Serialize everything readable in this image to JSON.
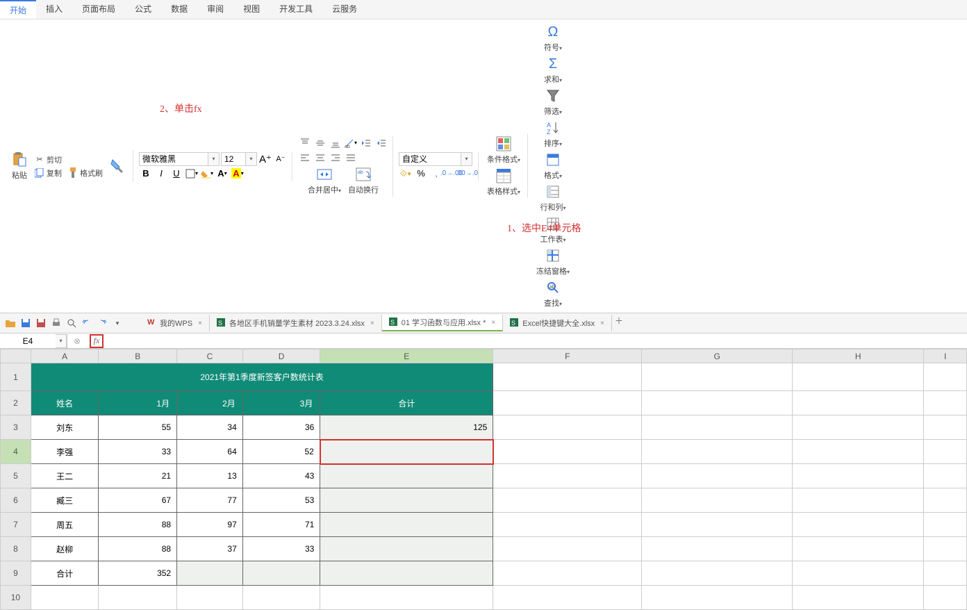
{
  "menu": {
    "tabs": [
      "开始",
      "插入",
      "页面布局",
      "公式",
      "数据",
      "审阅",
      "视图",
      "开发工具",
      "云服务"
    ],
    "active": 0
  },
  "ribbon": {
    "paste": "粘贴",
    "cut": "剪切",
    "copy": "复制",
    "format_painter": "格式刷",
    "font_name": "微软雅黑",
    "font_size": "12",
    "merge": "合并居中",
    "wrap": "自动换行",
    "num_format": "自定义",
    "cond_fmt": "条件格式",
    "table_style": "表格样式",
    "symbols": "符号",
    "sum": "求和",
    "filter": "筛选",
    "sort": "排序",
    "format": "格式",
    "rowcol": "行和列",
    "sheet": "工作表",
    "freeze": "冻结窗格",
    "find": "查找"
  },
  "doc_tabs": {
    "items": [
      {
        "label": "我的WPS",
        "icon": "wps"
      },
      {
        "label": "各地区手机销量学生素材 2023.3.24.xlsx",
        "icon": "excel"
      },
      {
        "label": "01 学习函数与应用.xlsx *",
        "icon": "excel",
        "active": true
      },
      {
        "label": "Excel快捷键大全.xlsx",
        "icon": "excel"
      }
    ]
  },
  "name_box": "E4",
  "annotations": {
    "a1": "1、选中E4单元格",
    "a2": "2、单击fx"
  },
  "col_headers": [
    "A",
    "B",
    "C",
    "D",
    "E",
    "F",
    "G",
    "H",
    "I"
  ],
  "selected_col_idx": 4,
  "selected_row": 4,
  "chart_data": {
    "type": "table",
    "title": "2021年第1季度新签客户数统计表",
    "columns": [
      "姓名",
      "1月",
      "2月",
      "3月",
      "合计"
    ],
    "rows": [
      {
        "name": "刘东",
        "m1": 55,
        "m2": 34,
        "m3": 36,
        "total": 125
      },
      {
        "name": "李强",
        "m1": 33,
        "m2": 64,
        "m3": 52,
        "total": ""
      },
      {
        "name": "王二",
        "m1": 21,
        "m2": 13,
        "m3": 43,
        "total": ""
      },
      {
        "name": "臧三",
        "m1": 67,
        "m2": 77,
        "m3": 53,
        "total": ""
      },
      {
        "name": "周五",
        "m1": 88,
        "m2": 97,
        "m3": 71,
        "total": ""
      },
      {
        "name": "赵柳",
        "m1": 88,
        "m2": 37,
        "m3": 33,
        "total": ""
      }
    ],
    "footer": {
      "label": "合计",
      "m1": 352,
      "m2": "",
      "m3": "",
      "total": ""
    }
  }
}
